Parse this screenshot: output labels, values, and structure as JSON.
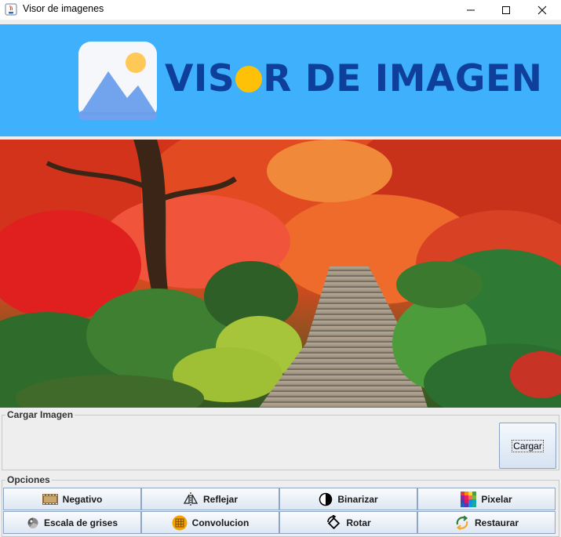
{
  "window": {
    "title": "Visor de imagenes",
    "icon": "java-cup-icon",
    "controls": [
      "minimize-icon",
      "maximize-icon",
      "close-icon"
    ]
  },
  "banner": {
    "title_part1": "VIS",
    "title_part2": "R DE IMAGEN",
    "logo_icon": "image-picture-icon",
    "bg_color": "#3fb0fc",
    "text_color": "#0d3f9b",
    "accent_color": "#ffc107"
  },
  "image_panel": {
    "content": "autumn-garden-stairs-photo"
  },
  "load_group": {
    "label": "Cargar Imagen",
    "button_label": "Cargar"
  },
  "options_group": {
    "label": "Opciones",
    "buttons": [
      {
        "label": "Negativo",
        "icon": "film-negative-icon"
      },
      {
        "label": "Reflejar",
        "icon": "mirror-flip-icon"
      },
      {
        "label": "Binarizar",
        "icon": "half-circle-contrast-icon"
      },
      {
        "label": "Pixelar",
        "icon": "pixel-grid-icon"
      },
      {
        "label": "Escala de grises",
        "icon": "grayscale-disc-icon"
      },
      {
        "label": "Convolucion",
        "icon": "filter-grid-icon"
      },
      {
        "label": "Rotar",
        "icon": "rotate-icon"
      },
      {
        "label": "Restaurar",
        "icon": "restore-arrows-icon"
      }
    ]
  }
}
